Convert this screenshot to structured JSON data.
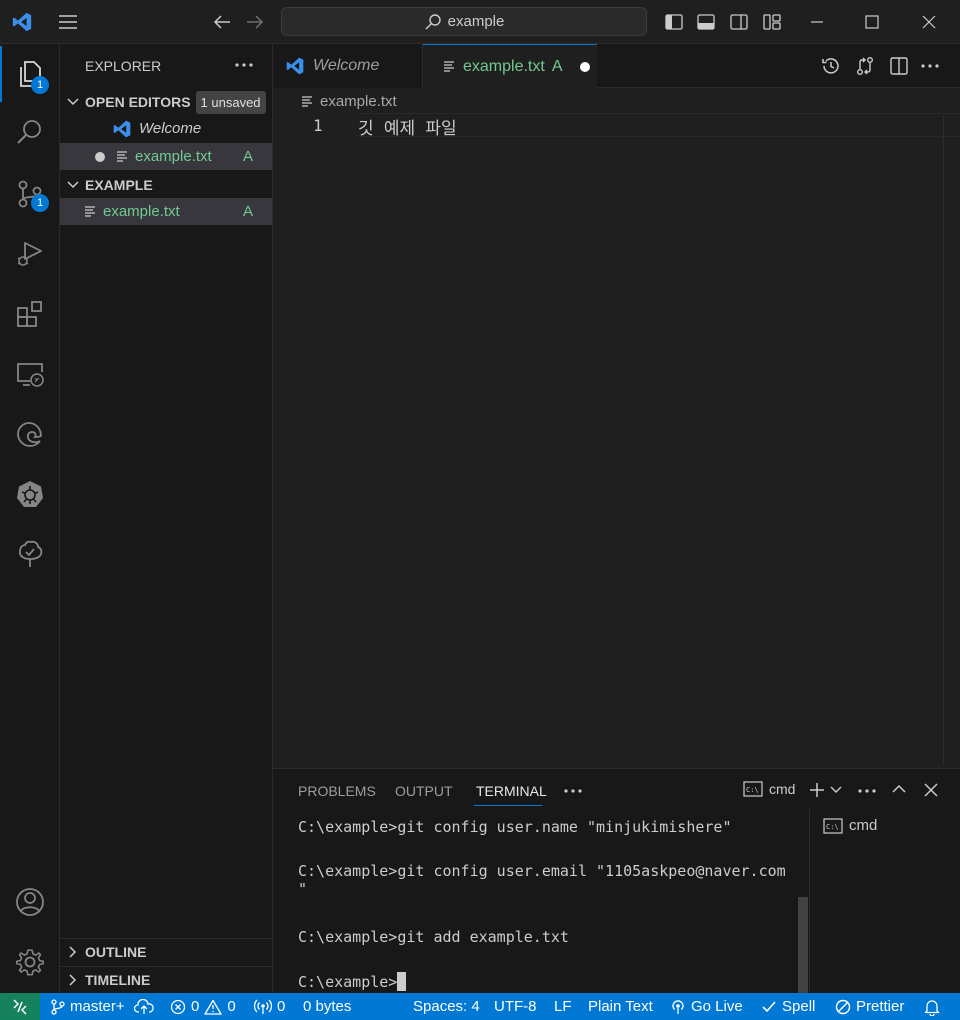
{
  "titlebar": {
    "search_text": "example"
  },
  "activity": {
    "explorer_badge": "1",
    "scm_badge": "1"
  },
  "sidebar": {
    "title": "EXPLORER",
    "open_editors": {
      "header": "OPEN EDITORS",
      "unsaved_badge": "1 unsaved",
      "items": [
        {
          "label": "Welcome"
        },
        {
          "label": "example.txt",
          "status": "A"
        }
      ]
    },
    "folder": {
      "header": "EXAMPLE",
      "items": [
        {
          "label": "example.txt",
          "status": "A"
        }
      ]
    },
    "outline_header": "OUTLINE",
    "timeline_header": "TIMELINE"
  },
  "tabs": [
    {
      "label": "Welcome"
    },
    {
      "label": "example.txt",
      "status": "A"
    }
  ],
  "editor": {
    "breadcrumb": "example.txt",
    "line_number": "1",
    "line_text": "깃 예제 파일"
  },
  "panel": {
    "tabs": [
      "PROBLEMS",
      "OUTPUT",
      "TERMINAL"
    ],
    "active_tab": "TERMINAL",
    "shell_label": "cmd",
    "terminal_list_item": "cmd",
    "terminal_lines": [
      "C:\\example>git config user.name \"minjukimishere\"",
      "C:\\example>git config user.email \"1105askpeo@naver.com",
      "\"",
      "C:\\example>git add example.txt",
      "C:\\example>"
    ]
  },
  "statusbar": {
    "branch": "master+",
    "errors": "0",
    "warnings": "0",
    "ports": "0",
    "size": "0 bytes",
    "spaces": "Spaces: 4",
    "encoding": "UTF-8",
    "eol": "LF",
    "language": "Plain Text",
    "golive": "Go Live",
    "spell": "Spell",
    "prettier": "Prettier"
  },
  "colors": {
    "accent": "#0078d4",
    "git_added": "#73c991",
    "vscode_blue": "#3b8eea"
  }
}
